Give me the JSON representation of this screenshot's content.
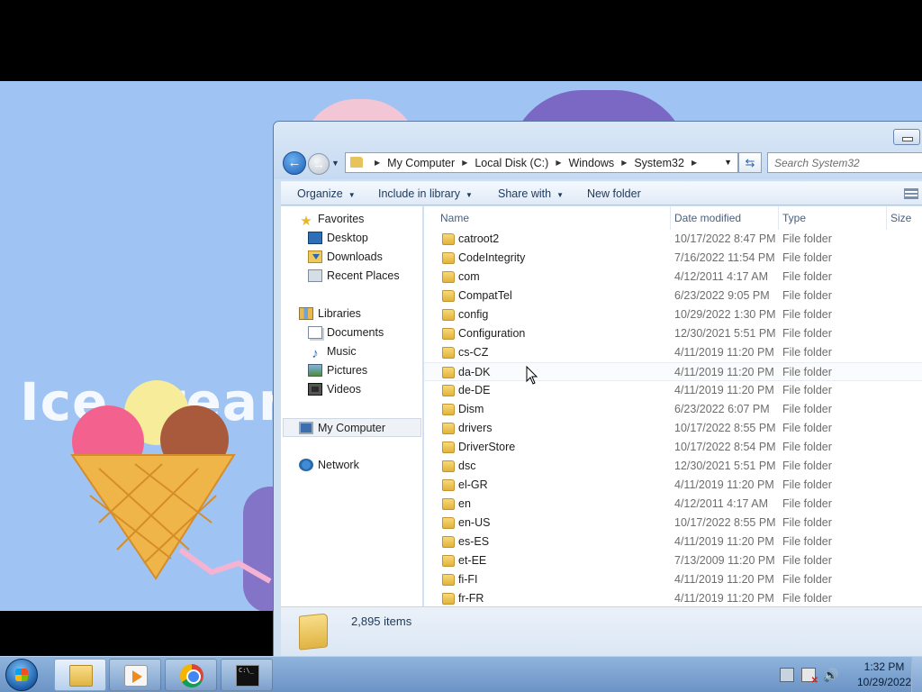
{
  "wallpaper": {
    "title": "Ice cream"
  },
  "explorer": {
    "address": {
      "crumbs": [
        "My Computer",
        "Local Disk (C:)",
        "Windows",
        "System32"
      ]
    },
    "search": {
      "placeholder": "Search System32"
    },
    "toolbar": {
      "organize": "Organize",
      "include_in_library": "Include in library",
      "share_with": "Share with",
      "new_folder": "New folder"
    },
    "nav": {
      "favorites": "Favorites",
      "desktop": "Desktop",
      "downloads": "Downloads",
      "recent_places": "Recent Places",
      "libraries": "Libraries",
      "documents": "Documents",
      "music": "Music",
      "pictures": "Pictures",
      "videos": "Videos",
      "my_computer": "My Computer",
      "network": "Network"
    },
    "columns": {
      "name": "Name",
      "date_modified": "Date modified",
      "type": "Type",
      "size": "Size"
    },
    "files": [
      {
        "name": "catroot2",
        "date": "10/17/2022 8:47 PM",
        "type": "File folder"
      },
      {
        "name": "CodeIntegrity",
        "date": "7/16/2022 11:54 PM",
        "type": "File folder"
      },
      {
        "name": "com",
        "date": "4/12/2011 4:17 AM",
        "type": "File folder"
      },
      {
        "name": "CompatTel",
        "date": "6/23/2022 9:05 PM",
        "type": "File folder"
      },
      {
        "name": "config",
        "date": "10/29/2022 1:30 PM",
        "type": "File folder"
      },
      {
        "name": "Configuration",
        "date": "12/30/2021 5:51 PM",
        "type": "File folder"
      },
      {
        "name": "cs-CZ",
        "date": "4/11/2019 11:20 PM",
        "type": "File folder"
      },
      {
        "name": "da-DK",
        "date": "4/11/2019 11:20 PM",
        "type": "File folder"
      },
      {
        "name": "de-DE",
        "date": "4/11/2019 11:20 PM",
        "type": "File folder"
      },
      {
        "name": "Dism",
        "date": "6/23/2022 6:07 PM",
        "type": "File folder"
      },
      {
        "name": "drivers",
        "date": "10/17/2022 8:55 PM",
        "type": "File folder"
      },
      {
        "name": "DriverStore",
        "date": "10/17/2022 8:54 PM",
        "type": "File folder"
      },
      {
        "name": "dsc",
        "date": "12/30/2021 5:51 PM",
        "type": "File folder"
      },
      {
        "name": "el-GR",
        "date": "4/11/2019 11:20 PM",
        "type": "File folder"
      },
      {
        "name": "en",
        "date": "4/12/2011 4:17 AM",
        "type": "File folder"
      },
      {
        "name": "en-US",
        "date": "10/17/2022 8:55 PM",
        "type": "File folder"
      },
      {
        "name": "es-ES",
        "date": "4/11/2019 11:20 PM",
        "type": "File folder"
      },
      {
        "name": "et-EE",
        "date": "7/13/2009 11:20 PM",
        "type": "File folder"
      },
      {
        "name": "fi-FI",
        "date": "4/11/2019 11:20 PM",
        "type": "File folder"
      },
      {
        "name": "fr-FR",
        "date": "4/11/2019 11:20 PM",
        "type": "File folder"
      }
    ],
    "hovered_item": "da-DK",
    "status": {
      "item_count": "2,895 items"
    }
  },
  "taskbar": {
    "clock_time": "1:32 PM",
    "clock_date": "10/29/2022"
  },
  "colors": {
    "wallpaper_bg": "#9fc3f2",
    "window_frame": "#cfe0f3",
    "taskbar": "#7ba2d1"
  }
}
